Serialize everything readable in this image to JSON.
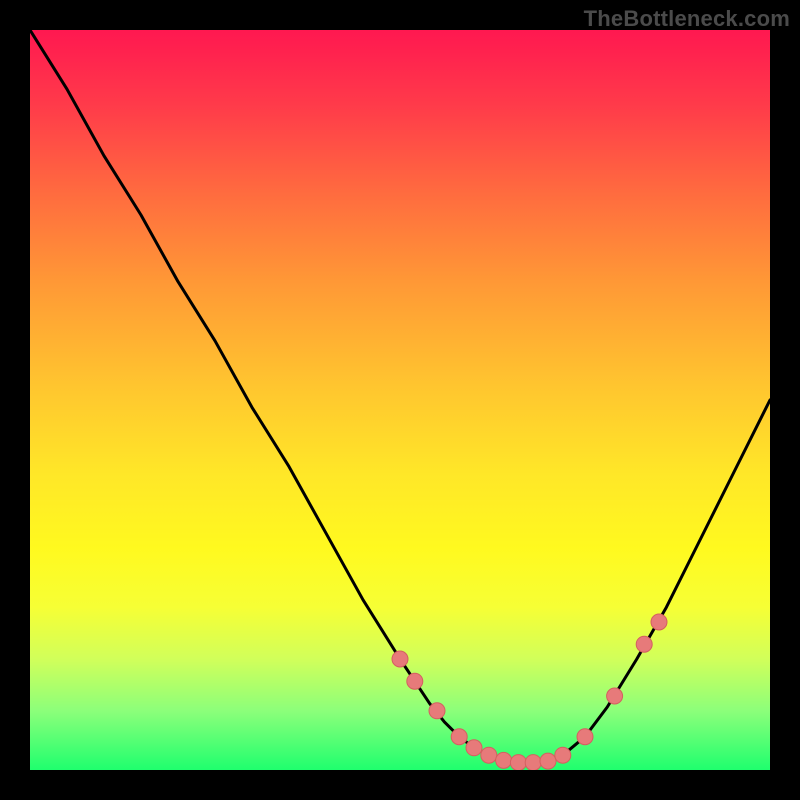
{
  "watermark": "TheBottleneck.com",
  "colors": {
    "curve_stroke": "#000000",
    "marker_fill": "#e77a7a",
    "marker_stroke": "#d46060"
  },
  "chart_data": {
    "type": "line",
    "title": "",
    "xlabel": "",
    "ylabel": "",
    "xlim": [
      0,
      100
    ],
    "ylim": [
      0,
      100
    ],
    "grid": false,
    "curve": {
      "x": [
        0,
        5,
        10,
        15,
        20,
        25,
        30,
        35,
        40,
        45,
        50,
        52,
        54,
        56,
        58,
        60,
        62,
        64,
        66,
        68,
        70,
        72,
        75,
        78,
        82,
        86,
        90,
        95,
        100
      ],
      "y": [
        100,
        92,
        83,
        75,
        66,
        58,
        49,
        41,
        32,
        23,
        15,
        12,
        9,
        6.5,
        4.5,
        3.0,
        2.0,
        1.3,
        1.0,
        1.0,
        1.2,
        2.0,
        4.5,
        8.5,
        15,
        22,
        30,
        40,
        50
      ]
    },
    "markers": {
      "x": [
        50,
        52,
        55,
        58,
        60,
        62,
        64,
        66,
        68,
        70,
        72,
        75,
        79,
        83,
        85
      ],
      "y": [
        15,
        12,
        8,
        4.5,
        3.0,
        2.0,
        1.3,
        1.0,
        1.0,
        1.2,
        2.0,
        4.5,
        10,
        17,
        20
      ]
    }
  }
}
